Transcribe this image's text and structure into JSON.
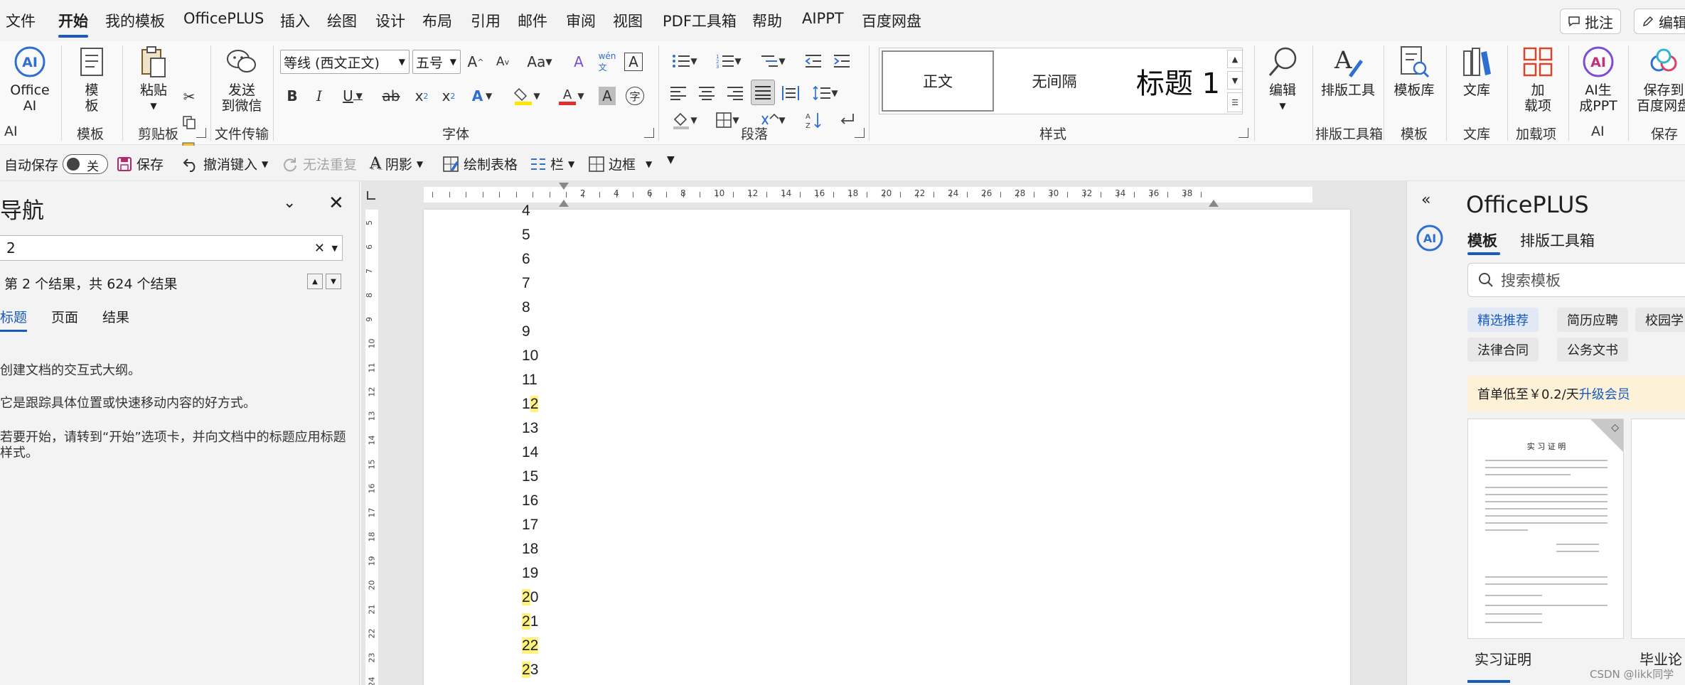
{
  "menu": {
    "items": [
      "文件",
      "开始",
      "我的模板",
      "OfficePLUS",
      "插入",
      "绘图",
      "设计",
      "布局",
      "引用",
      "邮件",
      "审阅",
      "视图",
      "PDF工具箱",
      "帮助",
      "AIPPT",
      "百度网盘"
    ],
    "active": "开始",
    "comment_btn": "批注",
    "edit_btn": "编辑"
  },
  "ribbon": {
    "office_ai": "Office AI",
    "office_ai_l1": "Office",
    "office_ai_l2": "AI",
    "template_l1": "模",
    "template_l2": "板",
    "paste": "粘贴",
    "send_wechat_l1": "发送",
    "send_wechat_l2": "到微信",
    "font_name": "等线 (西文正文)",
    "font_size": "五号",
    "styles": [
      "正文",
      "无间隔",
      "标题 1"
    ],
    "edit": "编辑",
    "layout_tool": "排版工具",
    "template_lib": "模板库",
    "library": "文库",
    "addin_l1": "加",
    "addin_l2": "载项",
    "ai_ppt_l1": "AI生",
    "ai_ppt_l2": "成PPT",
    "save_baidu_l1": "保存到",
    "save_baidu_l2": "百度网盘",
    "groups": {
      "ai": "AI",
      "template": "模板",
      "clipboard": "剪贴板",
      "file_transfer": "文件传输",
      "font": "字体",
      "paragraph": "段落",
      "styles": "样式",
      "layout_toolbox": "排版工具箱",
      "template2": "模板",
      "library": "文库",
      "addins": "加载项",
      "save": "保存"
    }
  },
  "qat": {
    "autosave": "自动保存",
    "autosave_state": "关",
    "save": "保存",
    "undo": "撤消键入",
    "redo": "无法重复",
    "shadow": "阴影",
    "draw_table": "绘制表格",
    "columns": "栏",
    "border": "边框"
  },
  "nav": {
    "title": "导航",
    "search_value": "2",
    "result": "第 2 个结果，共 624 个结果",
    "tabs": [
      "标题",
      "页面",
      "结果"
    ],
    "p1": "创建文档的交互式大纲。",
    "p2": "它是跟踪具体位置或快速移动内容的好方式。",
    "p3": "若要开始，请转到“开始”选项卡，并向文档中的标题应用标题样式。"
  },
  "ruler": {
    "h_ticks": [
      "2",
      "4",
      "6",
      "8",
      "10",
      "12",
      "14",
      "16",
      "18",
      "20",
      "22",
      "24",
      "26",
      "28",
      "30",
      "32",
      "34",
      "36",
      "38"
    ],
    "v_ticks": [
      "5",
      "6",
      "7",
      "8",
      "9",
      "10",
      "11",
      "12",
      "13",
      "14",
      "15",
      "16",
      "17",
      "18",
      "19",
      "20",
      "21",
      "22",
      "23",
      "24"
    ]
  },
  "document": {
    "lines": [
      {
        "pre": "4",
        "hl": "",
        "post": ""
      },
      {
        "pre": "5",
        "hl": "",
        "post": ""
      },
      {
        "pre": "6",
        "hl": "",
        "post": ""
      },
      {
        "pre": "7",
        "hl": "",
        "post": ""
      },
      {
        "pre": "8",
        "hl": "",
        "post": ""
      },
      {
        "pre": "9",
        "hl": "",
        "post": ""
      },
      {
        "pre": "10",
        "hl": "",
        "post": ""
      },
      {
        "pre": "11",
        "hl": "",
        "post": ""
      },
      {
        "pre": "1",
        "hl": "2",
        "post": ""
      },
      {
        "pre": "13",
        "hl": "",
        "post": ""
      },
      {
        "pre": "14",
        "hl": "",
        "post": ""
      },
      {
        "pre": "15",
        "hl": "",
        "post": ""
      },
      {
        "pre": "16",
        "hl": "",
        "post": ""
      },
      {
        "pre": "17",
        "hl": "",
        "post": ""
      },
      {
        "pre": "18",
        "hl": "",
        "post": ""
      },
      {
        "pre": "19",
        "hl": "",
        "post": ""
      },
      {
        "pre": "",
        "hl": "2",
        "post": "0"
      },
      {
        "pre": "",
        "hl": "2",
        "post": "1"
      },
      {
        "pre": "",
        "hl": "22",
        "post": ""
      },
      {
        "pre": "",
        "hl": "2",
        "post": "3"
      }
    ]
  },
  "officeplus": {
    "title": "OfficePLUS",
    "tabs": [
      "模板",
      "排版工具箱"
    ],
    "search_placeholder": "搜索模板",
    "chips": [
      "精选推荐",
      "简历应聘",
      "校园学习",
      "法律合同",
      "公务文书"
    ],
    "promo_text": "首单低至￥0.2/天",
    "promo_link": "升级会员",
    "thumbs": [
      "实习证明",
      "毕业论"
    ],
    "thumb_title": "实 习 证 明"
  },
  "watermark": "CSDN @likk同学",
  "colors": {
    "accent": "#185abd",
    "highlight": "#fff27a"
  }
}
